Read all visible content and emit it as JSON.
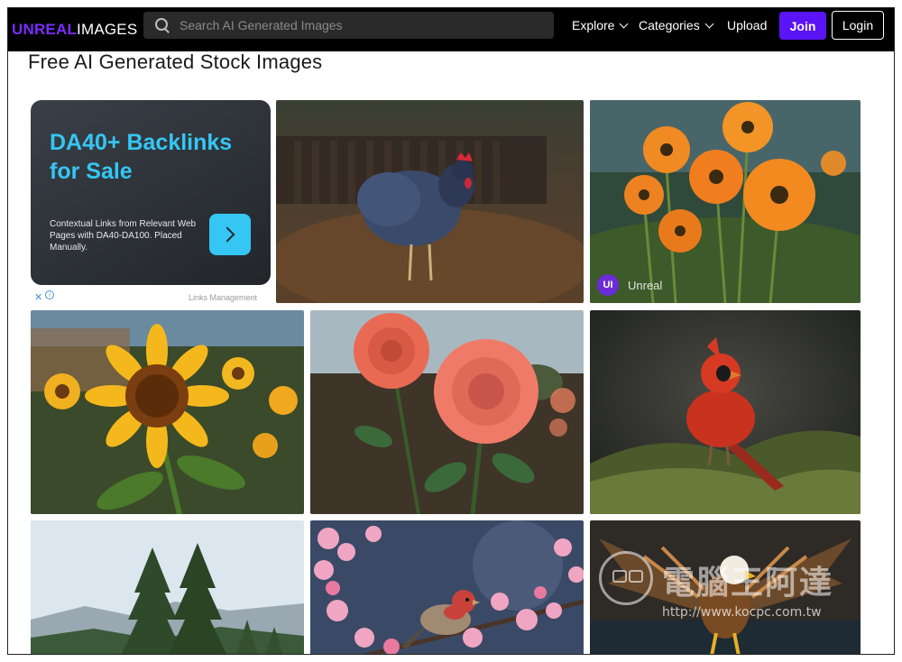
{
  "logo": {
    "part1": "UNREAL",
    "part2": " IMAGES"
  },
  "search": {
    "placeholder": "Search AI Generated Images"
  },
  "nav": {
    "explore": "Explore",
    "categories": "Categories",
    "upload": "Upload",
    "join": "Join",
    "login": "Login"
  },
  "page": {
    "title": "Free AI Generated Stock Images"
  },
  "ad": {
    "headline_line1": "DA40+ Backlinks",
    "headline_line2": "for Sale",
    "body": "Contextual Links from Relevant Web Pages with DA40-DA100. Placed Manually.",
    "close_glyph": "✕",
    "info_glyph": "i",
    "tag": "Links Management"
  },
  "gallery": {
    "badge_initials": "UI",
    "badge_label": "Unreal",
    "items": [
      {
        "name": "chicken-image",
        "subject": "Hen in autumn leaves"
      },
      {
        "name": "poppies-image",
        "subject": "Orange poppies"
      },
      {
        "name": "sunflower-image",
        "subject": "Sunflower"
      },
      {
        "name": "rose-image",
        "subject": "Pink roses"
      },
      {
        "name": "cardinal-image",
        "subject": "Red cardinal"
      },
      {
        "name": "pine-trees-image",
        "subject": "Pine trees"
      },
      {
        "name": "finch-blossom-image",
        "subject": "Finch on blossom"
      },
      {
        "name": "eagle-image",
        "subject": "Eagle in flight"
      }
    ]
  },
  "watermark": {
    "text": "電腦王阿達",
    "url": "http://www.kocpc.com.tw"
  },
  "colors": {
    "navbar_bg": "#000000",
    "brand_purple": "#7b2cff",
    "join_bg": "#5b14f5",
    "ad_accent": "#35c6f4"
  }
}
